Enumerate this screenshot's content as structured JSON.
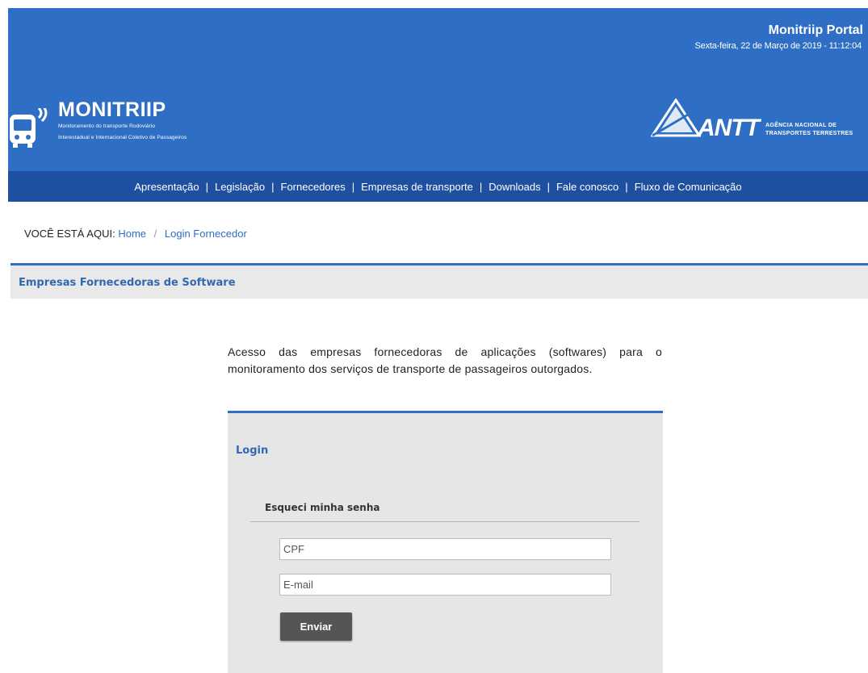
{
  "header": {
    "portal_title": "Monitriip Portal",
    "date_text": "Sexta-feira, 22 de Março de 2019 - 11:12:04",
    "logo_title": "MONITRIIP",
    "logo_subtitle_1": "Monitoramento do transporte Rodoviário",
    "logo_subtitle_2": "Interestadual e Internacional Coletivo de Passageiros",
    "antt_text": "ANTT",
    "antt_agency_1": "AGÊNCIA NACIONAL DE",
    "antt_agency_2": "TRANSPORTES TERRESTRES",
    "colors": {
      "header_bg": "#2e6ec4",
      "nav_bg": "#1e4fa0"
    }
  },
  "nav": {
    "items": [
      "Apresentação",
      "Legislação",
      "Fornecedores",
      "Empresas de transporte",
      "Downloads",
      "Fale conosco",
      "Fluxo de Comunicação"
    ],
    "separator": "|"
  },
  "breadcrumb": {
    "prefix": "VOCÊ ESTÁ AQUI:",
    "home": "Home",
    "separator": "/",
    "current": "Login Fornecedor"
  },
  "section": {
    "title": "Empresas Fornecedoras de Software"
  },
  "intro": {
    "text": "Acesso das empresas fornecedoras de aplicações (softwares) para o monitoramento dos serviços de transporte de passageiros outorgados."
  },
  "login": {
    "title": "Login",
    "forgot_title": "Esqueci minha senha",
    "cpf_placeholder": "CPF",
    "email_placeholder": "E-mail",
    "submit_label": "Enviar"
  }
}
